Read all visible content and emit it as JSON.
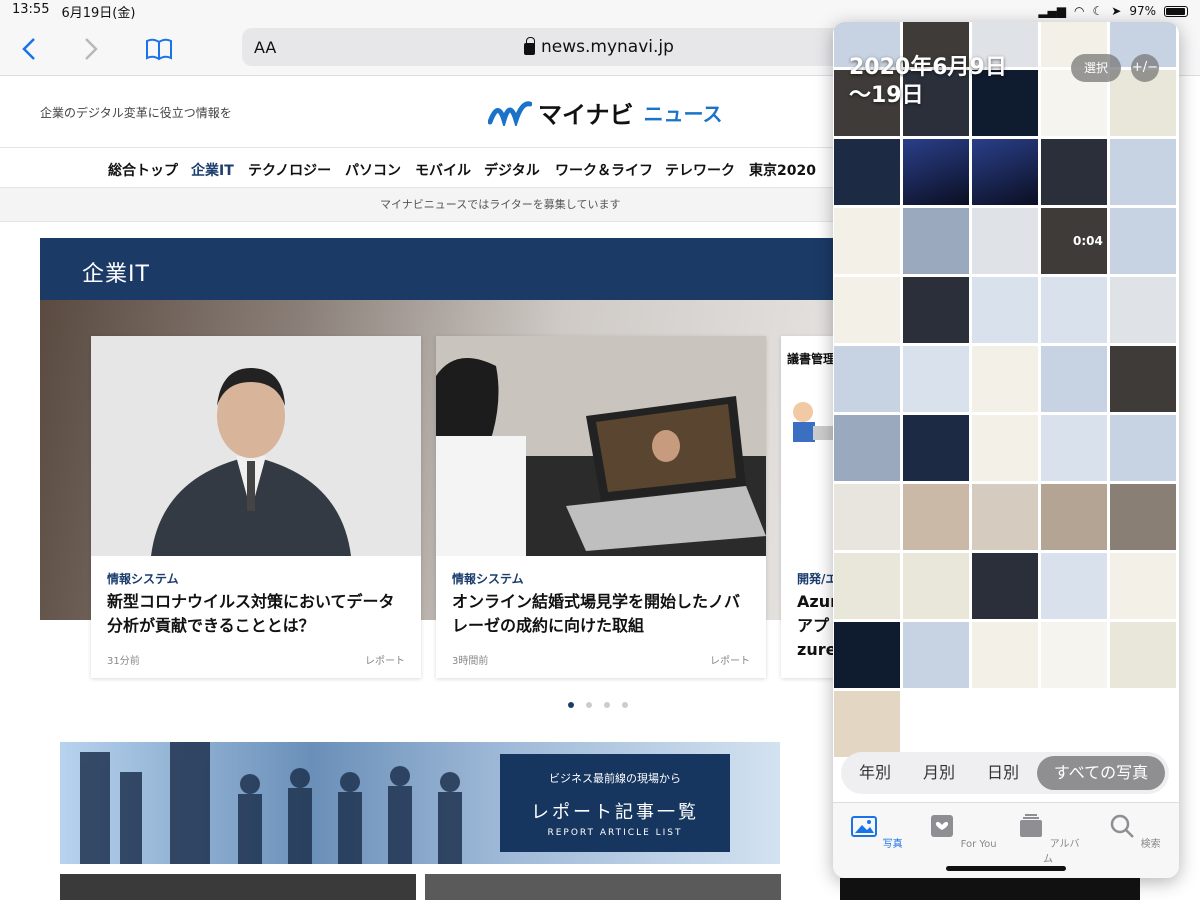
{
  "status": {
    "time": "13:55",
    "date": "6月19日(金)",
    "battery": "97%",
    "battery_level": 0.97
  },
  "safari": {
    "aa": "AA",
    "domain": "news.mynavi.jp"
  },
  "site": {
    "tagline": "企業のデジタル変革に役立つ情報を",
    "logo_main": "マイナビ",
    "logo_sub": "ニュース",
    "nav": [
      "総合トップ",
      "企業IT",
      "テクノロジー",
      "パソコン",
      "モバイル",
      "デジタル",
      "ワーク＆ライフ",
      "テレワーク",
      "東京2020"
    ],
    "nav_active": "企業IT",
    "recruit_notice": "マイナビニュースではライターを募集しています",
    "section_title": "企業IT",
    "cards": [
      {
        "category": "情報システム",
        "title": "新型コロナウイルス対策においてデータ分析が貢献できることとは？",
        "time": "31分前",
        "kind": "レポート"
      },
      {
        "category": "情報システム",
        "title": "オンライン結婚式場見学を開始したノバレーゼの成約に向けた取組",
        "time": "3時間前",
        "kind": "レポート"
      },
      {
        "category": "開発/エ",
        "title_line1": "Azur",
        "title_line2": "アプ",
        "title_line3": "zure",
        "image_text": "議書管理"
      }
    ],
    "report_banner": {
      "line1": "ビジネス最前線の現場から",
      "line2": "レポート記事一覧",
      "line3": "REPORT ARTICLE LIST"
    }
  },
  "photos": {
    "title_line1": "2020年6月9日",
    "title_line2": "〜19日",
    "select_label": "選択",
    "zoom_label": "+/−",
    "video_duration": "0:04",
    "segments": [
      "年別",
      "月別",
      "日別",
      "すべての写真"
    ],
    "segment_active": "すべての写真",
    "tabs": [
      "写真",
      "For You",
      "アルバム",
      "検索"
    ],
    "tab_active": "写真"
  },
  "colors": {
    "accent": "#1a73e8",
    "brand_navy": "#1b3a66",
    "logo_blue": "#1a73c8"
  }
}
